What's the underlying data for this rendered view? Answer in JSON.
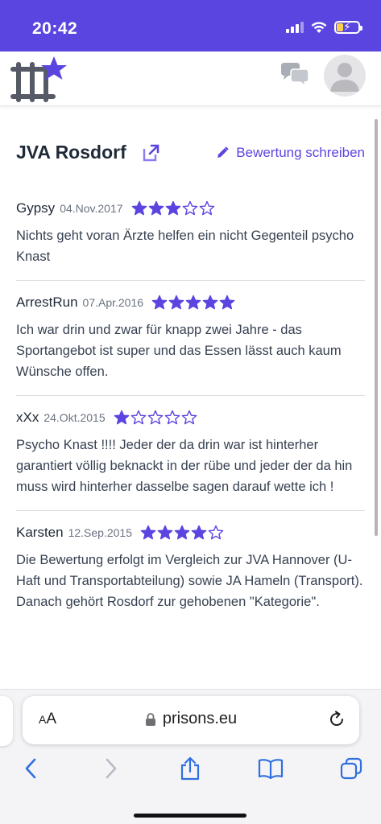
{
  "status_bar": {
    "time": "20:42"
  },
  "header": {
    "logo": "prisons-logo",
    "chat_icon": "chat-bubbles-icon",
    "avatar_icon": "user-avatar-icon"
  },
  "page": {
    "title": "JVA Rosdorf",
    "external_link_icon": "external-link-icon",
    "write_review_label": "Bewertung schreiben"
  },
  "reviews": [
    {
      "author": "Gypsy",
      "date": "04.Nov.2017",
      "rating": 3,
      "text": "Nichts geht voran Ärzte helfen ein nicht Gegenteil psycho Knast"
    },
    {
      "author": "ArrestRun",
      "date": "07.Apr.2016",
      "rating": 5,
      "text": "Ich war drin und zwar für knapp zwei Jahre - das Sportangebot ist super und das Essen lässt auch kaum Wünsche offen."
    },
    {
      "author": "xXx",
      "date": "24.Okt.2015",
      "rating": 1,
      "text": "Psycho Knast !!!! Jeder der da drin war ist hinterher garantiert völlig beknackt in der rübe und jeder der da hin muss wird hinterher dasselbe sagen darauf wette ich !"
    },
    {
      "author": "Karsten",
      "date": "12.Sep.2015",
      "rating": 4,
      "text": "Die Bewertung erfolgt im Vergleich zur JVA Hannover (U-Haft und Transportabteilung) sowie JA Hameln (Transport). Danach gehört Rosdorf zur gehobenen \"Kategorie\"."
    }
  ],
  "browser": {
    "aa_label_small": "A",
    "aa_label_large": "A",
    "url": "prisons.eu",
    "toolbar": [
      "back-icon",
      "forward-icon",
      "share-icon",
      "bookmarks-icon",
      "tabs-icon"
    ]
  },
  "colors": {
    "accent": "#5b45e0",
    "star": "#5b45e0"
  }
}
